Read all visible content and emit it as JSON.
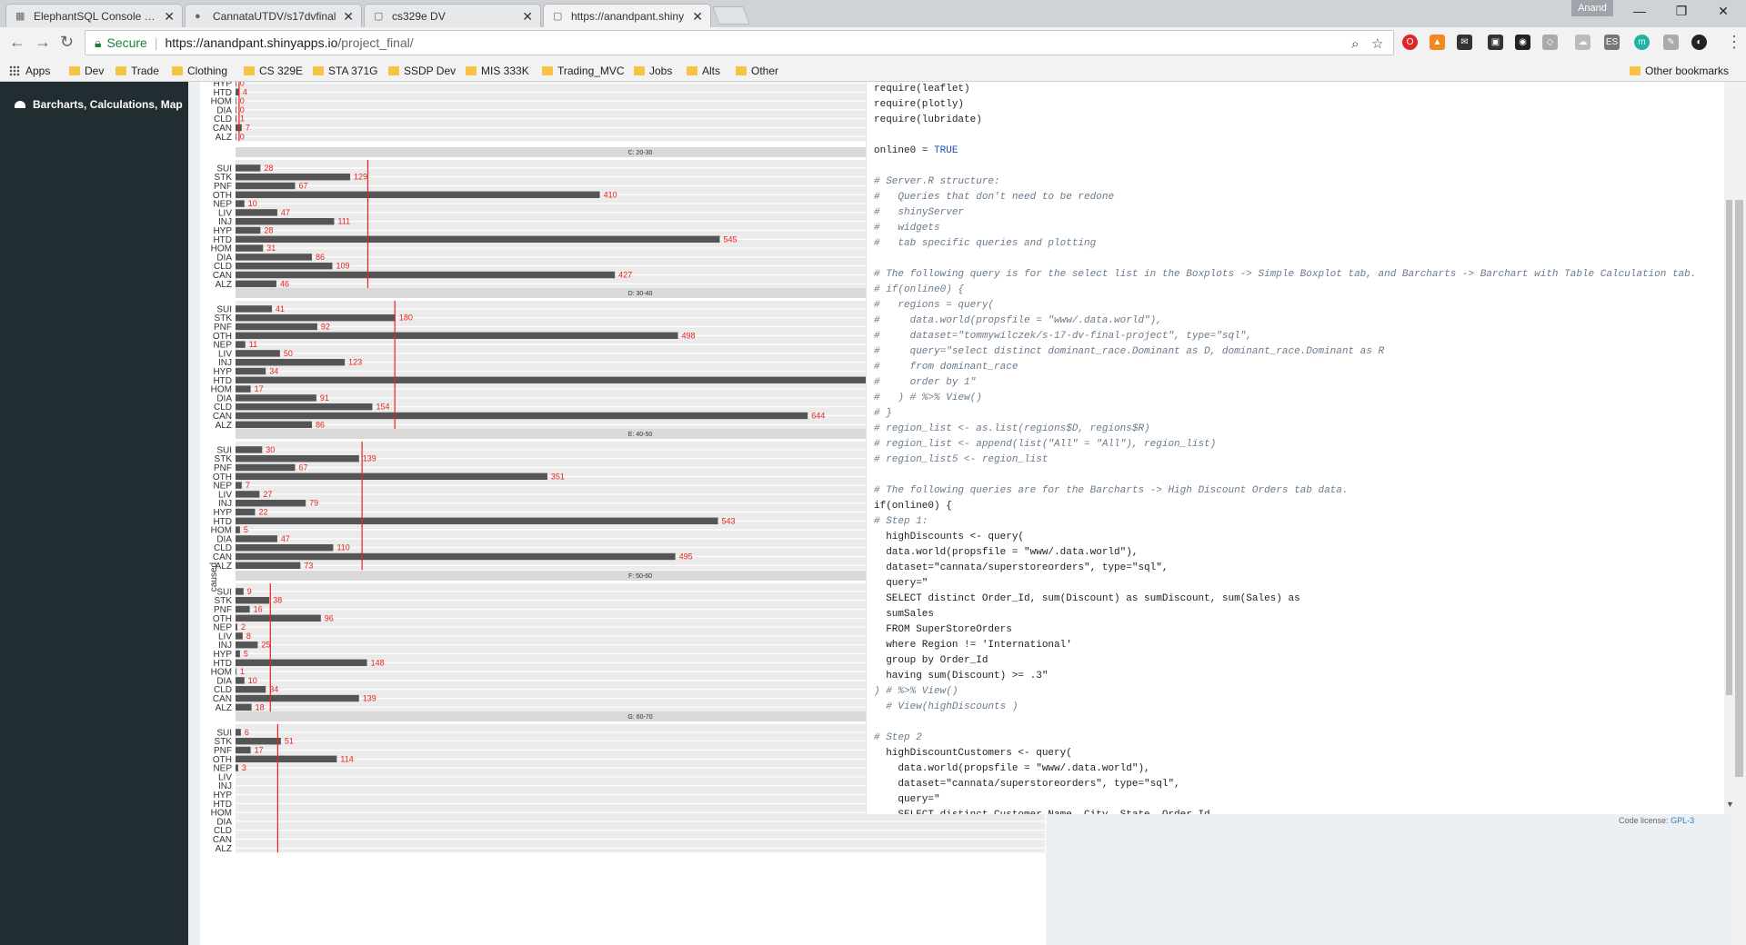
{
  "browser": {
    "tabs": [
      {
        "label": "ElephantSQL Console Ste",
        "icon": "elephant-icon",
        "active": false
      },
      {
        "label": "CannataUTDV/s17dvfinal",
        "icon": "github-icon",
        "active": false
      },
      {
        "label": "cs329e DV",
        "icon": "page-icon",
        "active": false
      },
      {
        "label": "https://anandpant.shiny",
        "icon": "page-icon",
        "active": true
      }
    ],
    "profile_label": "Anand",
    "secure_label": "Secure",
    "url_host": "https://anandpant.shinyapps.io",
    "url_path": "/project_final/",
    "bookmarks": [
      "Apps",
      "Dev",
      "Trade",
      "Clothing",
      "CS 329E",
      "STA 371G",
      "SSDP Dev",
      "MIS 333K",
      "Trading_MVC",
      "Jobs",
      "Alts",
      "Other"
    ],
    "other_bookmarks": "Other bookmarks"
  },
  "sidebar": {
    "item_label": "Barcharts, Calculations, Map",
    "item_icon": "dashboard-icon"
  },
  "chart_data": {
    "type": "bar",
    "orientation": "horizontal",
    "facet_by": "age group",
    "ylabel": "caused",
    "ref_line_color": "#e8231f",
    "bar_color": "#555555",
    "categories": [
      "SUI",
      "STK",
      "PNF",
      "OTH",
      "NEP",
      "LIV",
      "INJ",
      "HYP",
      "HTD",
      "HOM",
      "DIA",
      "CLD",
      "CAN",
      "ALZ"
    ],
    "panels": [
      {
        "title": "",
        "partial_top": true,
        "values": [
          null,
          null,
          null,
          null,
          null,
          0,
          4,
          0,
          4,
          0,
          0,
          1,
          7,
          0
        ]
      },
      {
        "title": "C: 20-30",
        "values": [
          28,
          129,
          67,
          410,
          10,
          47,
          111,
          28,
          545,
          31,
          86,
          109,
          427,
          46
        ]
      },
      {
        "title": "D: 30-40",
        "values": [
          41,
          180,
          92,
          498,
          11,
          50,
          123,
          34,
          null,
          17,
          91,
          154,
          644,
          86
        ]
      },
      {
        "title": "E: 40-50",
        "values": [
          30,
          139,
          67,
          351,
          7,
          27,
          79,
          22,
          543,
          5,
          47,
          110,
          495,
          73
        ]
      },
      {
        "title": "F: 50-60",
        "values": [
          9,
          38,
          16,
          96,
          2,
          8,
          25,
          5,
          148,
          1,
          10,
          34,
          139,
          18
        ]
      },
      {
        "title": "G: 60-70",
        "partial_bottom": true,
        "values": [
          6,
          51,
          17,
          114,
          3,
          null,
          null,
          null,
          null,
          null,
          null,
          null,
          null,
          null
        ]
      }
    ]
  },
  "code": {
    "lines": [
      {
        "t": "require(leaflet)",
        "c": ""
      },
      {
        "t": "require(plotly)",
        "c": ""
      },
      {
        "t": "require(lubridate)",
        "c": ""
      },
      {
        "t": "",
        "c": ""
      },
      {
        "t": "online0 = TRUE",
        "c": "kwend"
      },
      {
        "t": "",
        "c": ""
      },
      {
        "t": "# Server.R structure:",
        "c": "cmt"
      },
      {
        "t": "#   Queries that don't need to be redone",
        "c": "cmt"
      },
      {
        "t": "#   shinyServer",
        "c": "cmt"
      },
      {
        "t": "#   widgets",
        "c": "cmt"
      },
      {
        "t": "#   tab specific queries and plotting",
        "c": "cmt"
      },
      {
        "t": "",
        "c": ""
      },
      {
        "t": "# The following query is for the select list in the Boxplots -> Simple Boxplot tab, and Barcharts -> Barchart with Table Calculation tab.",
        "c": "cmt"
      },
      {
        "t": "# if(online0) {",
        "c": "cmt"
      },
      {
        "t": "#   regions = query(",
        "c": "cmt"
      },
      {
        "t": "#     data.world(propsfile = \"www/.data.world\"),",
        "c": "cmt"
      },
      {
        "t": "#     dataset=\"tommywilczek/s-17-dv-final-project\", type=\"sql\",",
        "c": "cmt"
      },
      {
        "t": "#     query=\"select distinct dominant_race.Dominant as D, dominant_race.Dominant as R",
        "c": "cmt"
      },
      {
        "t": "#     from dominant_race",
        "c": "cmt"
      },
      {
        "t": "#     order by 1\"",
        "c": "cmt"
      },
      {
        "t": "#   ) # %>% View()",
        "c": "cmt"
      },
      {
        "t": "# }",
        "c": "cmt"
      },
      {
        "t": "# region_list <- as.list(regions$D, regions$R)",
        "c": "cmt"
      },
      {
        "t": "# region_list <- append(list(\"All\" = \"All\"), region_list)",
        "c": "cmt"
      },
      {
        "t": "# region_list5 <- region_list",
        "c": "cmt"
      },
      {
        "t": "",
        "c": ""
      },
      {
        "t": "# The following queries are for the Barcharts -> High Discount Orders tab data.",
        "c": "cmt"
      },
      {
        "t": "if(online0) {",
        "c": "kwif"
      },
      {
        "t": "# Step 1:",
        "c": "cmt"
      },
      {
        "t": "  highDiscounts <- query(",
        "c": ""
      },
      {
        "t": "  data.world(propsfile = \"www/.data.world\"),",
        "c": ""
      },
      {
        "t": "  dataset=\"cannata/superstoreorders\", type=\"sql\",",
        "c": ""
      },
      {
        "t": "  query=\"",
        "c": ""
      },
      {
        "t": "  SELECT distinct Order_Id, sum(Discount) as sumDiscount, sum(Sales) as",
        "c": ""
      },
      {
        "t": "  sumSales",
        "c": ""
      },
      {
        "t": "  FROM SuperStoreOrders",
        "c": ""
      },
      {
        "t": "  where Region != 'International'",
        "c": ""
      },
      {
        "t": "  group by Order_Id",
        "c": ""
      },
      {
        "t": "  having sum(Discount) >= .3\"",
        "c": ""
      },
      {
        "t": ") # %>% View()",
        "c": "cmt"
      },
      {
        "t": "  # View(highDiscounts )",
        "c": "cmt"
      },
      {
        "t": "",
        "c": ""
      },
      {
        "t": "# Step 2",
        "c": "cmt"
      },
      {
        "t": "  highDiscountCustomers <- query(",
        "c": ""
      },
      {
        "t": "    data.world(propsfile = \"www/.data.world\"),",
        "c": ""
      },
      {
        "t": "    dataset=\"cannata/superstoreorders\", type=\"sql\",",
        "c": ""
      },
      {
        "t": "    query=\"",
        "c": ""
      },
      {
        "t": "    SELECT distinct Customer_Name, City, State, Order_Id",
        "c": ""
      }
    ],
    "license_label": "Code license:",
    "license_link": "GPL-3"
  }
}
